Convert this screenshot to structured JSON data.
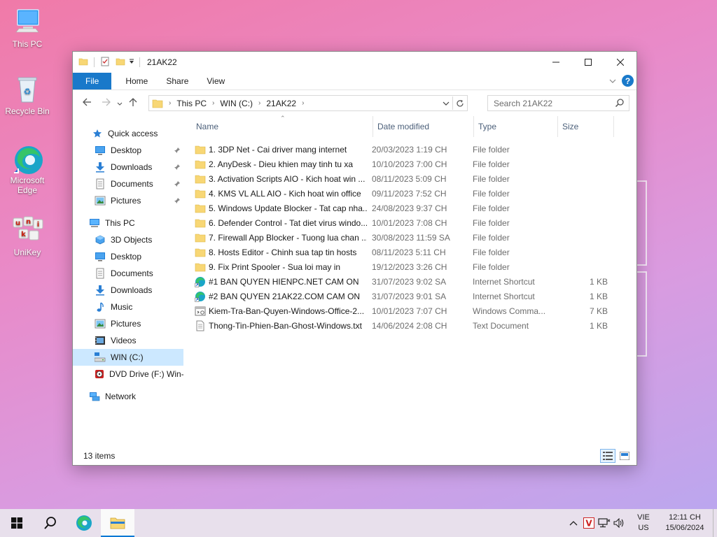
{
  "desktop": {
    "icons": [
      {
        "label": "This PC"
      },
      {
        "label": "Recycle Bin"
      },
      {
        "label": "Microsoft Edge"
      },
      {
        "label": "UniKey"
      }
    ]
  },
  "window": {
    "title": "21AK22",
    "ribbon_tabs": [
      "File",
      "Home",
      "Share",
      "View"
    ],
    "help_label": "?",
    "address": {
      "crumbs": [
        "This PC",
        "WIN (C:)",
        "21AK22"
      ]
    },
    "search_placeholder": "Search 21AK22",
    "nav_pane": {
      "quick_access": "Quick access",
      "quick_items": [
        "Desktop",
        "Downloads",
        "Documents",
        "Pictures"
      ],
      "this_pc": "This PC",
      "pc_items": [
        "3D Objects",
        "Desktop",
        "Documents",
        "Downloads",
        "Music",
        "Pictures",
        "Videos",
        "WIN (C:)",
        "DVD Drive (F:) Win-"
      ],
      "network": "Network"
    },
    "columns": {
      "name": "Name",
      "date": "Date modified",
      "type": "Type",
      "size": "Size"
    },
    "files": [
      {
        "name": "1. 3DP Net - Cai driver mang internet",
        "date": "20/03/2023 1:19 CH",
        "type": "File folder",
        "size": "",
        "icon": "folder-icon"
      },
      {
        "name": "2. AnyDesk - Dieu khien may tinh tu xa",
        "date": "10/10/2023 7:00 CH",
        "type": "File folder",
        "size": "",
        "icon": "folder-icon"
      },
      {
        "name": "3. Activation Scripts AIO - Kich hoat win ...",
        "date": "08/11/2023 5:09 CH",
        "type": "File folder",
        "size": "",
        "icon": "folder-icon"
      },
      {
        "name": "4. KMS VL ALL AIO - Kich hoat win office",
        "date": "09/11/2023 7:52 CH",
        "type": "File folder",
        "size": "",
        "icon": "folder-icon"
      },
      {
        "name": "5. Windows Update Blocker - Tat cap nha...",
        "date": "24/08/2023 9:37 CH",
        "type": "File folder",
        "size": "",
        "icon": "folder-icon"
      },
      {
        "name": "6. Defender Control - Tat diet virus windo...",
        "date": "10/01/2023 7:08 CH",
        "type": "File folder",
        "size": "",
        "icon": "folder-icon"
      },
      {
        "name": "7. Firewall App Blocker - Tuong lua chan ...",
        "date": "30/08/2023 11:59 SA",
        "type": "File folder",
        "size": "",
        "icon": "folder-icon"
      },
      {
        "name": "8. Hosts Editor - Chinh sua tap tin hosts",
        "date": "08/11/2023 5:11 CH",
        "type": "File folder",
        "size": "",
        "icon": "folder-icon"
      },
      {
        "name": "9. Fix Print Spooler - Sua loi may in",
        "date": "19/12/2023 3:26 CH",
        "type": "File folder",
        "size": "",
        "icon": "folder-icon"
      },
      {
        "name": "#1 BAN QUYEN HIENPC.NET CAM ON",
        "date": "31/07/2023 9:02 SA",
        "type": "Internet Shortcut",
        "size": "1 KB",
        "icon": "edge-shortcut-icon"
      },
      {
        "name": "#2 BAN QUYEN 21AK22.COM CAM ON",
        "date": "31/07/2023 9:01 SA",
        "type": "Internet Shortcut",
        "size": "1 KB",
        "icon": "edge-shortcut-icon"
      },
      {
        "name": "Kiem-Tra-Ban-Quyen-Windows-Office-2...",
        "date": "10/01/2023 7:07 CH",
        "type": "Windows Comma...",
        "size": "7 KB",
        "icon": "cmd-file-icon"
      },
      {
        "name": "Thong-Tin-Phien-Ban-Ghost-Windows.txt",
        "date": "14/06/2024 2:08 CH",
        "type": "Text Document",
        "size": "1 KB",
        "icon": "text-file-icon"
      }
    ],
    "status": "13 items"
  },
  "taskbar": {
    "lang_line1": "VIE",
    "lang_line2": "US",
    "time": "12:11 CH",
    "date": "15/06/2024"
  },
  "colors": {
    "accent": "#1979ca",
    "folder": "#f8d775",
    "selected": "#cce8ff"
  }
}
